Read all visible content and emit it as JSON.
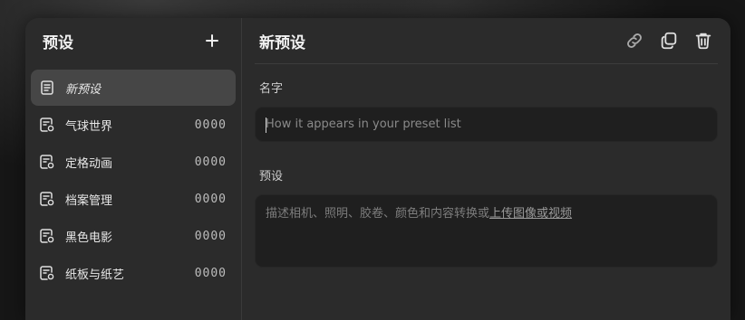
{
  "sidebar": {
    "title": "预设",
    "items": [
      {
        "label": "新预设",
        "count": "",
        "active": true,
        "icon": "document-icon"
      },
      {
        "label": "气球世界",
        "count": "0000",
        "active": false,
        "icon": "preset-document-icon"
      },
      {
        "label": "定格动画",
        "count": "0000",
        "active": false,
        "icon": "preset-document-icon"
      },
      {
        "label": "档案管理",
        "count": "0000",
        "active": false,
        "icon": "preset-document-icon"
      },
      {
        "label": "黑色电影",
        "count": "0000",
        "active": false,
        "icon": "preset-document-icon"
      },
      {
        "label": "纸板与纸艺",
        "count": "0000",
        "active": false,
        "icon": "preset-document-icon"
      }
    ]
  },
  "main": {
    "title": "新预设",
    "actions": [
      "link-icon",
      "copy-icon",
      "trash-icon"
    ],
    "name_label": "名字",
    "name_value": "",
    "name_placeholder": "How it appears in your preset list",
    "preset_label": "预设",
    "preset_placeholder": "描述相机、照明、胶卷、颜色和内容转换或",
    "preset_link": "上传图像或视频"
  },
  "colors": {
    "panel": "#2b2b2b",
    "active_item": "#464646",
    "input_bg": "#1f1f1f"
  }
}
